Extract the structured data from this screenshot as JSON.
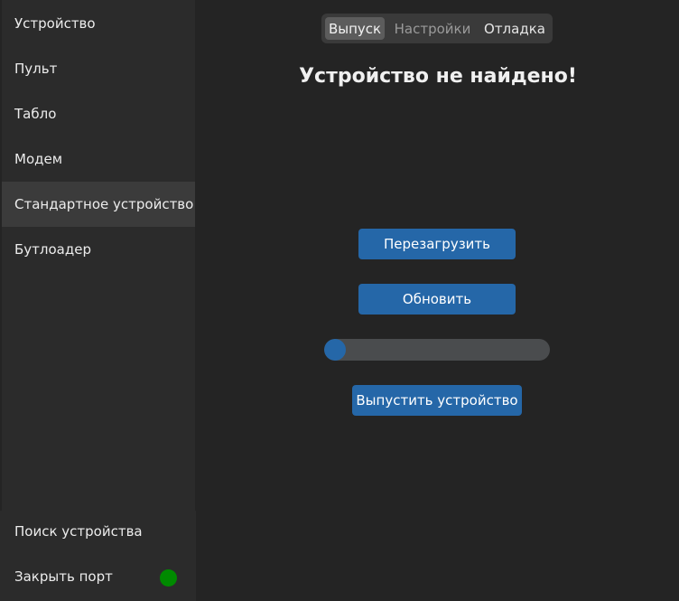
{
  "sidebar": {
    "items": [
      {
        "label": "Устройство"
      },
      {
        "label": "Пульт"
      },
      {
        "label": "Табло"
      },
      {
        "label": "Модем"
      },
      {
        "label": "Стандартное устройство"
      },
      {
        "label": "Бутлоадер"
      }
    ],
    "active_index": 4,
    "bottom_items": [
      {
        "label": "Поиск устройства"
      },
      {
        "label": "Закрыть порт"
      }
    ],
    "port_status_color": "#008a00"
  },
  "tabs": [
    {
      "label": "Выпуск",
      "state": "active"
    },
    {
      "label": "Настройки",
      "state": "dim"
    },
    {
      "label": "Отладка",
      "state": "normal"
    }
  ],
  "main": {
    "title": "Устройство не найдено!",
    "reboot_label": "Перезагрузить",
    "update_label": "Обновить",
    "release_label": "Выпустить устройство",
    "progress_percent": 5
  },
  "colors": {
    "accent": "#2567a8",
    "background": "#242424",
    "sidebar": "#2b2b2b"
  }
}
